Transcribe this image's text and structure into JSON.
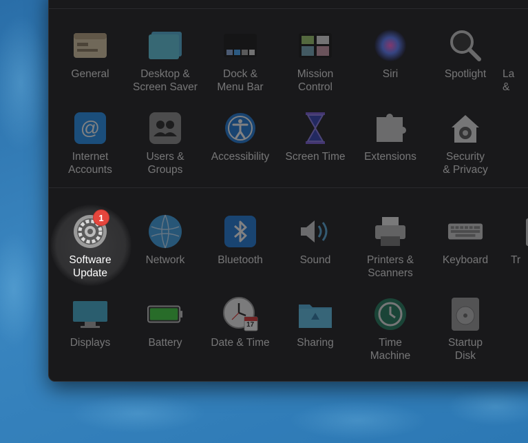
{
  "row1": [
    {
      "label": "General",
      "icon": "general-icon"
    },
    {
      "label": "Desktop &\nScreen Saver",
      "icon": "desktop-icon"
    },
    {
      "label": "Dock &\nMenu Bar",
      "icon": "dock-icon"
    },
    {
      "label": "Mission\nControl",
      "icon": "mission-control-icon"
    },
    {
      "label": "Siri",
      "icon": "siri-icon"
    },
    {
      "label": "Spotlight",
      "icon": "spotlight-icon"
    },
    {
      "label": "La\n&",
      "icon": "language-icon"
    }
  ],
  "row2": [
    {
      "label": "Internet\nAccounts",
      "icon": "at-icon"
    },
    {
      "label": "Users &\nGroups",
      "icon": "users-icon"
    },
    {
      "label": "Accessibility",
      "icon": "accessibility-icon"
    },
    {
      "label": "Screen Time",
      "icon": "hourglass-icon"
    },
    {
      "label": "Extensions",
      "icon": "puzzle-icon"
    },
    {
      "label": "Security\n& Privacy",
      "icon": "house-lock-icon"
    }
  ],
  "row3": [
    {
      "label": "Software\nUpdate",
      "icon": "gear-icon",
      "badge": "1"
    },
    {
      "label": "Network",
      "icon": "globe-icon"
    },
    {
      "label": "Bluetooth",
      "icon": "bluetooth-icon"
    },
    {
      "label": "Sound",
      "icon": "speaker-icon"
    },
    {
      "label": "Printers &\nScanners",
      "icon": "printer-icon"
    },
    {
      "label": "Keyboard",
      "icon": "keyboard-icon"
    },
    {
      "label": "Tr",
      "icon": "trackpad-icon"
    }
  ],
  "row4": [
    {
      "label": "Displays",
      "icon": "display-icon"
    },
    {
      "label": "Battery",
      "icon": "battery-icon"
    },
    {
      "label": "Date & Time",
      "icon": "clock-icon",
      "calendar_day": "17",
      "calendar_month": "JUL"
    },
    {
      "label": "Sharing",
      "icon": "folder-icon"
    },
    {
      "label": "Time\nMachine",
      "icon": "time-machine-icon"
    },
    {
      "label": "Startup\nDisk",
      "icon": "disk-icon"
    }
  ]
}
